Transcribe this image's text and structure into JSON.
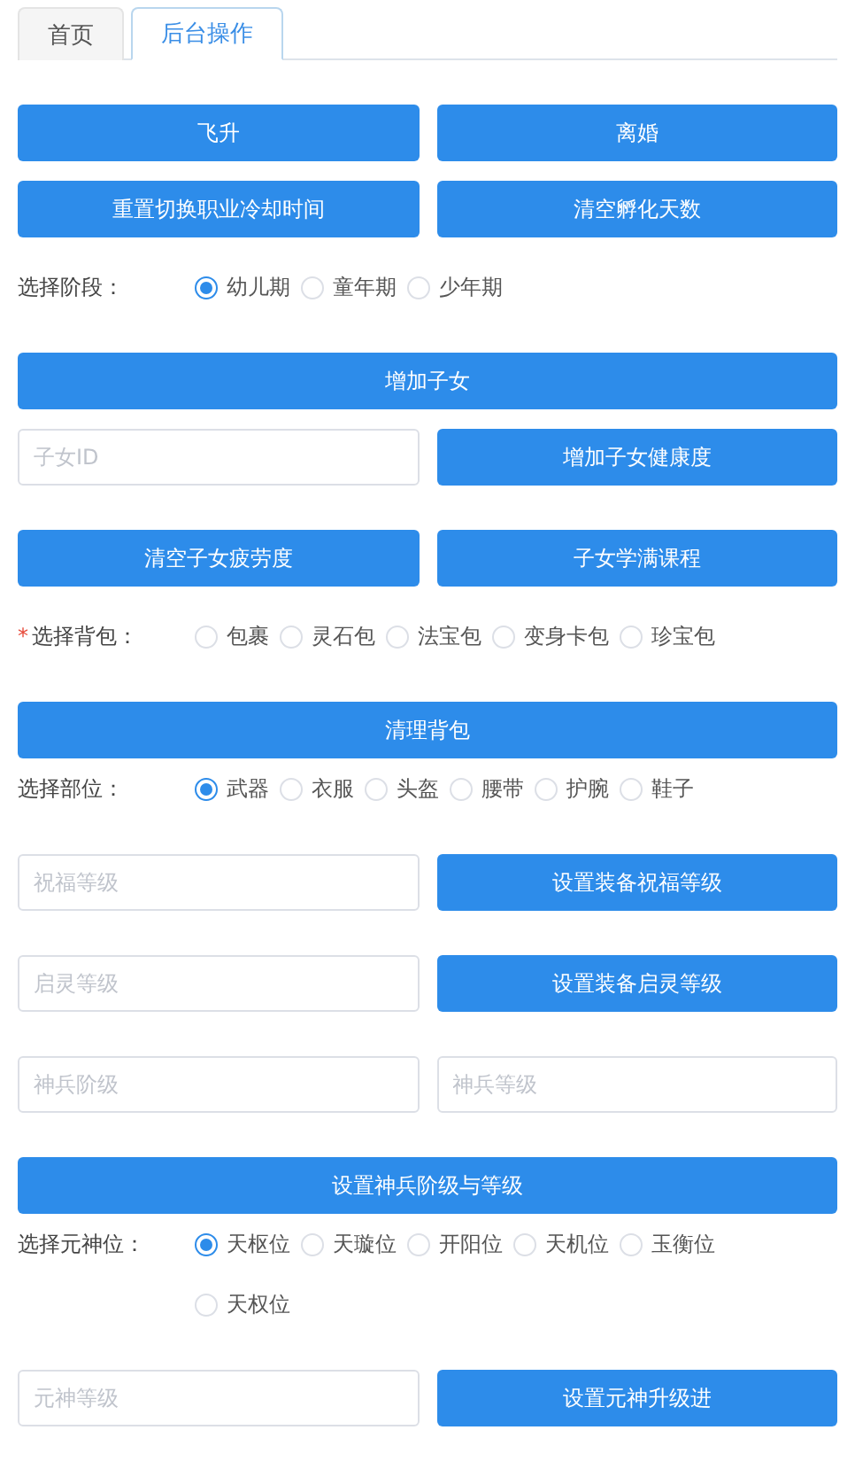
{
  "tabs": [
    {
      "label": "首页",
      "selected": false
    },
    {
      "label": "后台操作",
      "selected": true
    }
  ],
  "rows": [
    {
      "kind": "buttons",
      "buttons": [
        "飞升",
        "离婚"
      ]
    },
    {
      "kind": "buttons",
      "buttons": [
        "重置切换职业冷却时间",
        "清空孵化天数"
      ]
    },
    {
      "kind": "radio",
      "label": "选择阶段：",
      "options": [
        {
          "label": "幼儿期",
          "selected": true
        },
        {
          "label": "童年期",
          "selected": false
        },
        {
          "label": "少年期",
          "selected": false
        }
      ]
    },
    {
      "kind": "full_button",
      "button": "增加子女"
    },
    {
      "kind": "input_button",
      "placeholder": "子女ID",
      "button": "增加子女健康度"
    },
    {
      "kind": "buttons",
      "buttons": [
        "清空子女疲劳度",
        "子女学满课程"
      ]
    },
    {
      "kind": "radio",
      "label": "选择背包：",
      "required_mark": "*",
      "options": [
        {
          "label": "包裹",
          "selected": false
        },
        {
          "label": "灵石包",
          "selected": false
        },
        {
          "label": "法宝包",
          "selected": false
        },
        {
          "label": "变身卡包",
          "selected": false
        },
        {
          "label": "珍宝包",
          "selected": false
        }
      ]
    },
    {
      "kind": "full_button",
      "button": "清理背包"
    },
    {
      "kind": "radio",
      "label": "选择部位：",
      "options": [
        {
          "label": "武器",
          "selected": true
        },
        {
          "label": "衣服",
          "selected": false
        },
        {
          "label": "头盔",
          "selected": false
        },
        {
          "label": "腰带",
          "selected": false
        },
        {
          "label": "护腕",
          "selected": false
        },
        {
          "label": "鞋子",
          "selected": false
        }
      ]
    },
    {
      "kind": "input_button",
      "placeholder": "祝福等级",
      "button": "设置装备祝福等级"
    },
    {
      "kind": "input_button",
      "placeholder": "启灵等级",
      "button": "设置装备启灵等级"
    },
    {
      "kind": "inputs",
      "placeholders": [
        "神兵阶级",
        "神兵等级"
      ]
    },
    {
      "kind": "full_button",
      "button": "设置神兵阶级与等级"
    },
    {
      "kind": "radio",
      "label": "选择元神位：",
      "options": [
        {
          "label": "天枢位",
          "selected": true
        },
        {
          "label": "天璇位",
          "selected": false
        },
        {
          "label": "开阳位",
          "selected": false
        },
        {
          "label": "天机位",
          "selected": false
        },
        {
          "label": "玉衡位",
          "selected": false
        },
        {
          "label": "天权位",
          "selected": false
        }
      ]
    },
    {
      "kind": "input_button",
      "placeholder": "元神等级",
      "button": "设置元神升级进"
    }
  ]
}
